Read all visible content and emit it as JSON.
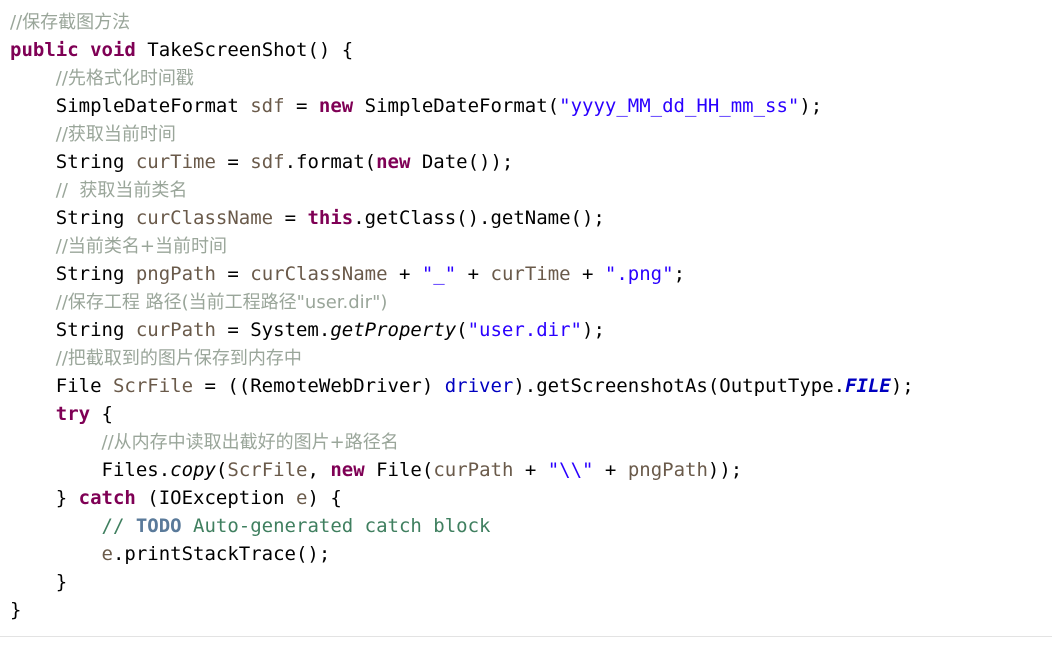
{
  "editor": {
    "language": "java",
    "background": "#ffffff",
    "font_size_px": 19,
    "line_height_px": 28,
    "colors": {
      "keyword": "#7f0055",
      "string": "#2a00ff",
      "field": "#0000c0",
      "local_variable": "#6a5a4a",
      "comment_cjk": "#9aa69a",
      "comment_en": "#3f7f5f",
      "todo_tag": "#5a7a9a",
      "plain": "#000000",
      "rule": "#e3e3e3"
    }
  },
  "code": {
    "lines": [
      {
        "number": 1,
        "indent": 0,
        "text": "//保存截图方法",
        "tokens": [
          {
            "kind": "comment_cjk",
            "text": "//保存截图方法"
          }
        ]
      },
      {
        "number": 2,
        "indent": 0,
        "text": "public void TakeScreenShot() {",
        "tokens": [
          {
            "kind": "keyword",
            "text": "public"
          },
          {
            "kind": "plain",
            "text": " "
          },
          {
            "kind": "keyword",
            "text": "void"
          },
          {
            "kind": "plain",
            "text": " TakeScreenShot() {"
          }
        ]
      },
      {
        "number": 3,
        "indent": 1,
        "text": "//先格式化时间戳",
        "tokens": [
          {
            "kind": "comment_cjk",
            "text": "//先格式化时间戳"
          }
        ]
      },
      {
        "number": 4,
        "indent": 1,
        "text": "SimpleDateFormat sdf = new SimpleDateFormat(\"yyyy_MM_dd_HH_mm_ss\");",
        "tokens": [
          {
            "kind": "plain",
            "text": "SimpleDateFormat "
          },
          {
            "kind": "local",
            "text": "sdf"
          },
          {
            "kind": "plain",
            "text": " = "
          },
          {
            "kind": "keyword",
            "text": "new"
          },
          {
            "kind": "plain",
            "text": " SimpleDateFormat("
          },
          {
            "kind": "string",
            "text": "\"yyyy_MM_dd_HH_mm_ss\""
          },
          {
            "kind": "plain",
            "text": ");"
          }
        ]
      },
      {
        "number": 5,
        "indent": 1,
        "text": "//获取当前时间",
        "tokens": [
          {
            "kind": "comment_cjk",
            "text": "//获取当前时间"
          }
        ]
      },
      {
        "number": 6,
        "indent": 1,
        "text": "String curTime = sdf.format(new Date());",
        "tokens": [
          {
            "kind": "plain",
            "text": "String "
          },
          {
            "kind": "local",
            "text": "curTime"
          },
          {
            "kind": "plain",
            "text": " = "
          },
          {
            "kind": "local",
            "text": "sdf"
          },
          {
            "kind": "plain",
            "text": ".format("
          },
          {
            "kind": "keyword",
            "text": "new"
          },
          {
            "kind": "plain",
            "text": " Date());"
          }
        ]
      },
      {
        "number": 7,
        "indent": 1,
        "text": "//  获取当前类名",
        "tokens": [
          {
            "kind": "comment_cjk",
            "text": "//  获取当前类名"
          }
        ]
      },
      {
        "number": 8,
        "indent": 1,
        "text": "String curClassName = this.getClass().getName();",
        "tokens": [
          {
            "kind": "plain",
            "text": "String "
          },
          {
            "kind": "local",
            "text": "curClassName"
          },
          {
            "kind": "plain",
            "text": " = "
          },
          {
            "kind": "keyword",
            "text": "this"
          },
          {
            "kind": "plain",
            "text": ".getClass().getName();"
          }
        ]
      },
      {
        "number": 9,
        "indent": 1,
        "text": "//当前类名+当前时间",
        "tokens": [
          {
            "kind": "comment_cjk",
            "text": "//当前类名+当前时间"
          }
        ]
      },
      {
        "number": 10,
        "indent": 1,
        "text": "String pngPath = curClassName + \"_\" + curTime + \".png\";",
        "tokens": [
          {
            "kind": "plain",
            "text": "String "
          },
          {
            "kind": "local",
            "text": "pngPath"
          },
          {
            "kind": "plain",
            "text": " = "
          },
          {
            "kind": "local",
            "text": "curClassName"
          },
          {
            "kind": "plain",
            "text": " + "
          },
          {
            "kind": "string",
            "text": "\"_\""
          },
          {
            "kind": "plain",
            "text": " + "
          },
          {
            "kind": "local",
            "text": "curTime"
          },
          {
            "kind": "plain",
            "text": " + "
          },
          {
            "kind": "string",
            "text": "\".png\""
          },
          {
            "kind": "plain",
            "text": ";"
          }
        ]
      },
      {
        "number": 11,
        "indent": 1,
        "text": "//保存工程 路径(当前工程路径\"user.dir\")",
        "tokens": [
          {
            "kind": "comment_cjk",
            "text": "//保存工程 路径(当前工程路径\"user.dir\")"
          }
        ]
      },
      {
        "number": 12,
        "indent": 1,
        "text": "String curPath = System.getProperty(\"user.dir\");",
        "tokens": [
          {
            "kind": "plain",
            "text": "String "
          },
          {
            "kind": "local",
            "text": "curPath"
          },
          {
            "kind": "plain",
            "text": " = System."
          },
          {
            "kind": "static_method",
            "text": "getProperty"
          },
          {
            "kind": "plain",
            "text": "("
          },
          {
            "kind": "string",
            "text": "\"user.dir\""
          },
          {
            "kind": "plain",
            "text": ");"
          }
        ]
      },
      {
        "number": 13,
        "indent": 1,
        "text": "//把截取到的图片保存到内存中",
        "tokens": [
          {
            "kind": "comment_cjk",
            "text": "//把截取到的图片保存到内存中"
          }
        ]
      },
      {
        "number": 14,
        "indent": 1,
        "text": "File ScrFile = ((RemoteWebDriver) driver).getScreenshotAs(OutputType.FILE);",
        "tokens": [
          {
            "kind": "plain",
            "text": "File "
          },
          {
            "kind": "local",
            "text": "ScrFile"
          },
          {
            "kind": "plain",
            "text": " = ((RemoteWebDriver) "
          },
          {
            "kind": "field",
            "text": "driver"
          },
          {
            "kind": "plain",
            "text": ").getScreenshotAs(OutputType."
          },
          {
            "kind": "static_field",
            "text": "FILE"
          },
          {
            "kind": "plain",
            "text": ");"
          }
        ]
      },
      {
        "number": 15,
        "indent": 1,
        "text": "try {",
        "tokens": [
          {
            "kind": "keyword",
            "text": "try"
          },
          {
            "kind": "plain",
            "text": " {"
          }
        ]
      },
      {
        "number": 16,
        "indent": 2,
        "text": "//从内存中读取出截好的图片+路径名",
        "tokens": [
          {
            "kind": "comment_cjk",
            "text": "//从内存中读取出截好的图片+路径名"
          }
        ]
      },
      {
        "number": 17,
        "indent": 2,
        "text": "Files.copy(ScrFile, new File(curPath + \"\\\\\" + pngPath));",
        "tokens": [
          {
            "kind": "plain",
            "text": "Files."
          },
          {
            "kind": "static_method",
            "text": "copy"
          },
          {
            "kind": "plain",
            "text": "("
          },
          {
            "kind": "local",
            "text": "ScrFile"
          },
          {
            "kind": "plain",
            "text": ", "
          },
          {
            "kind": "keyword",
            "text": "new"
          },
          {
            "kind": "plain",
            "text": " File("
          },
          {
            "kind": "local",
            "text": "curPath"
          },
          {
            "kind": "plain",
            "text": " + "
          },
          {
            "kind": "string",
            "text": "\"\\\\\""
          },
          {
            "kind": "plain",
            "text": " + "
          },
          {
            "kind": "local",
            "text": "pngPath"
          },
          {
            "kind": "plain",
            "text": "));"
          }
        ]
      },
      {
        "number": 18,
        "indent": 1,
        "text": "} catch (IOException e) {",
        "tokens": [
          {
            "kind": "plain",
            "text": "} "
          },
          {
            "kind": "keyword",
            "text": "catch"
          },
          {
            "kind": "plain",
            "text": " (IOException "
          },
          {
            "kind": "local",
            "text": "e"
          },
          {
            "kind": "plain",
            "text": ") {"
          }
        ]
      },
      {
        "number": 19,
        "indent": 2,
        "text": "// TODO Auto-generated catch block",
        "tokens": [
          {
            "kind": "comment_en",
            "text": "// "
          },
          {
            "kind": "todo",
            "text": "TODO"
          },
          {
            "kind": "comment_en",
            "text": " Auto-generated catch block"
          }
        ]
      },
      {
        "number": 20,
        "indent": 2,
        "text": "e.printStackTrace();",
        "tokens": [
          {
            "kind": "local",
            "text": "e"
          },
          {
            "kind": "plain",
            "text": ".printStackTrace();"
          }
        ]
      },
      {
        "number": 21,
        "indent": 1,
        "text": "}",
        "tokens": [
          {
            "kind": "plain",
            "text": "}"
          }
        ]
      },
      {
        "number": 22,
        "indent": 0,
        "text": "}",
        "tokens": [
          {
            "kind": "plain",
            "text": "}"
          }
        ]
      }
    ]
  }
}
